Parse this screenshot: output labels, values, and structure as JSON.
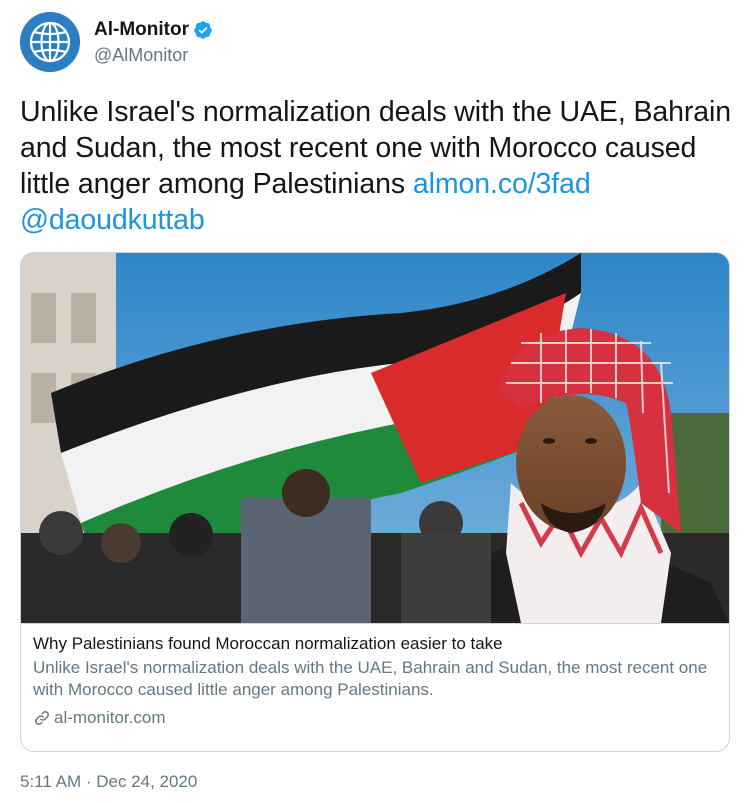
{
  "account": {
    "display_name": "Al-Monitor",
    "handle": "@AlMonitor",
    "verified": true,
    "avatar_icon": "globe-icon",
    "avatar_color": "#2b7fc0"
  },
  "tweet": {
    "text": "Unlike Israel's normalization deals with the UAE, Bahrain and Sudan, the most recent one with Morocco caused little anger among Palestinians ",
    "link": "almon.co/3fad",
    "mention": "@daoudkuttab",
    "link_color": "#1b95e0"
  },
  "card": {
    "image_description": "man-in-red-keffiyeh-with-palestinian-flag",
    "title": "Why Palestinians found Moroccan normalization easier to take",
    "description": "Unlike Israel's normalization deals with the UAE, Bahrain and Sudan, the most recent one with Morocco caused little anger among Palestinians.",
    "domain": "al-monitor.com",
    "domain_icon": "link-icon"
  },
  "meta": {
    "timestamp": "5:11 AM · Dec 24, 2020"
  }
}
